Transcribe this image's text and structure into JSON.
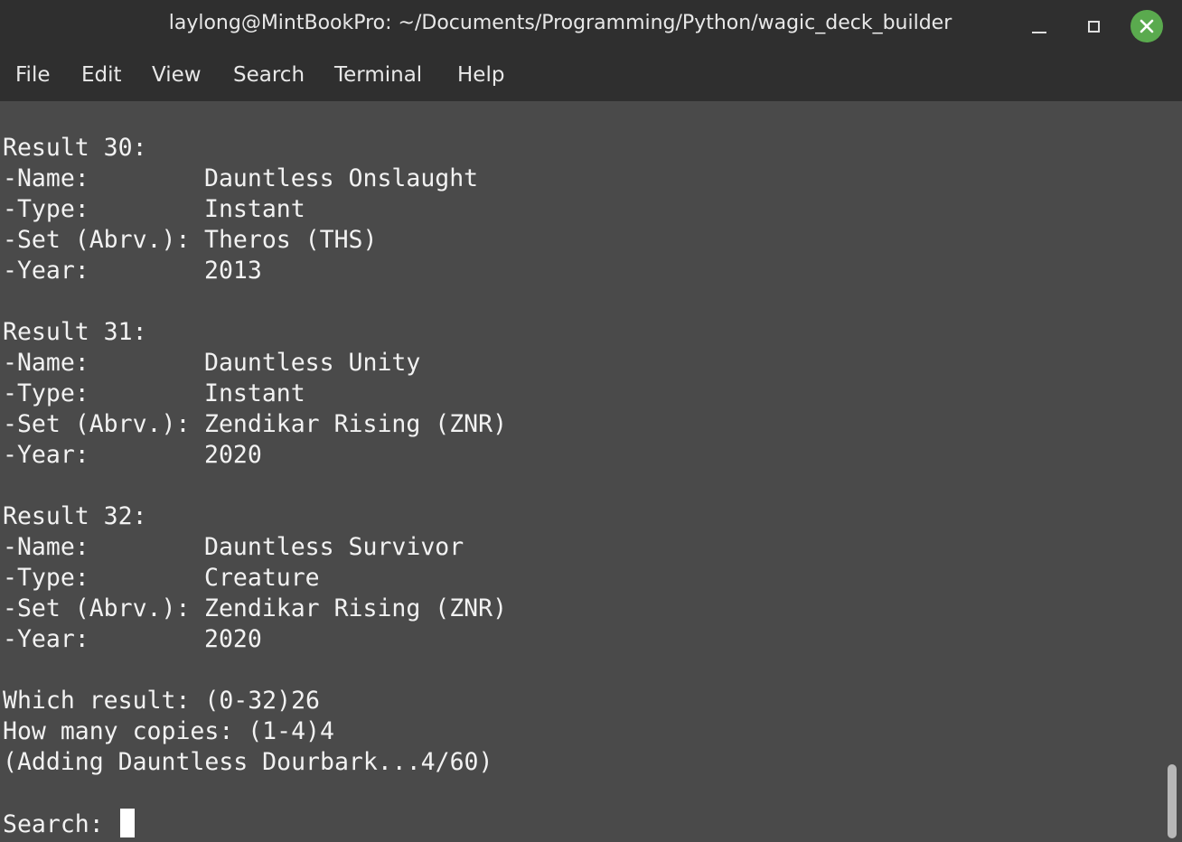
{
  "window": {
    "title": "laylong@MintBookPro: ~/Documents/Programming/Python/wagic_deck_builder"
  },
  "menu": {
    "items": [
      "File",
      "Edit",
      "View",
      "Search",
      "Terminal",
      "Help"
    ]
  },
  "terminal": {
    "results": [
      {
        "header": "Result 30:",
        "name_label": "-Name:",
        "name": "Dauntless Onslaught",
        "type_label": "-Type:",
        "type": "Instant",
        "set_label": "-Set (Abrv.):",
        "set": "Theros (THS)",
        "year_label": "-Year:",
        "year": "2013"
      },
      {
        "header": "Result 31:",
        "name_label": "-Name:",
        "name": "Dauntless Unity",
        "type_label": "-Type:",
        "type": "Instant",
        "set_label": "-Set (Abrv.):",
        "set": "Zendikar Rising (ZNR)",
        "year_label": "-Year:",
        "year": "2020"
      },
      {
        "header": "Result 32:",
        "name_label": "-Name:",
        "name": "Dauntless Survivor",
        "type_label": "-Type:",
        "type": "Creature",
        "set_label": "-Set (Abrv.):",
        "set": "Zendikar Rising (ZNR)",
        "year_label": "-Year:",
        "year": "2020"
      }
    ],
    "prompt_which": "Which result: (0-32)26",
    "prompt_copies": "How many copies: (1-4)4",
    "adding_status": "(Adding Dauntless Dourbark...4/60)",
    "search_prompt": "Search: "
  },
  "colors": {
    "titlebar": "#2f2f2f",
    "terminal_bg": "#4a4a4a",
    "text": "#f2f2f2",
    "close_button": "#5aaa4e"
  }
}
